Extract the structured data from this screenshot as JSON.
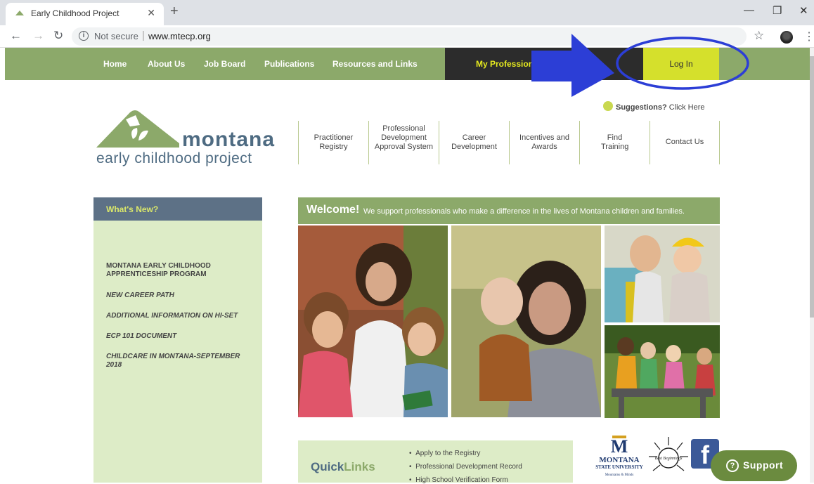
{
  "browser": {
    "tab_title": "Early Childhood Project",
    "not_secure": "Not secure",
    "url": "www.mtecp.org"
  },
  "nav": {
    "items": [
      "Home",
      "About Us",
      "Job Board",
      "Publications",
      "Resources and Links"
    ],
    "my_professional": "My Professiona",
    "login": "Log In"
  },
  "logo": {
    "name": "montana",
    "tagline": "early childhood project"
  },
  "suggestions": {
    "bold": "Suggestions?",
    "rest": " Click Here"
  },
  "secondary_nav": [
    "Practitioner Registry",
    "Professional Development Approval System",
    "Career Development",
    "Incentives and Awards",
    "Find Training",
    "Contact Us"
  ],
  "whats_new": {
    "title": "What's New?",
    "items": [
      "MONTANA EARLY CHILDHOOD APPRENTICESHIP PROGRAM",
      "NEW CAREER PATH",
      "ADDITIONAL INFORMATION ON HI-SET",
      "ECP 101 DOCUMENT",
      "CHILDCARE IN MONTANA-SEPTEMBER 2018"
    ]
  },
  "welcome": {
    "bold": "Welcome!",
    "text": "We support professionals who make a difference in the lives of Montana children and families."
  },
  "quicklinks": {
    "title_a": "Quick",
    "title_b": "Links",
    "items": [
      "Apply to the Registry",
      "Professional Development Record",
      "High School Verification Form"
    ]
  },
  "partners": {
    "msu_m": "M",
    "msu_name": "MONTANA",
    "msu_sub": "STATE UNIVERSITY",
    "msu_motto": "Mountains & Minds",
    "bb_name": "Best Beginnings",
    "fb_letter": "f"
  },
  "support": {
    "label": "Support"
  },
  "colors": {
    "nav_green": "#8ca96a",
    "login_yellow": "#d5e02c",
    "navy_text": "#4e6b82",
    "light_green": "#ddecc7",
    "annotation_blue": "#2c3ed6"
  }
}
